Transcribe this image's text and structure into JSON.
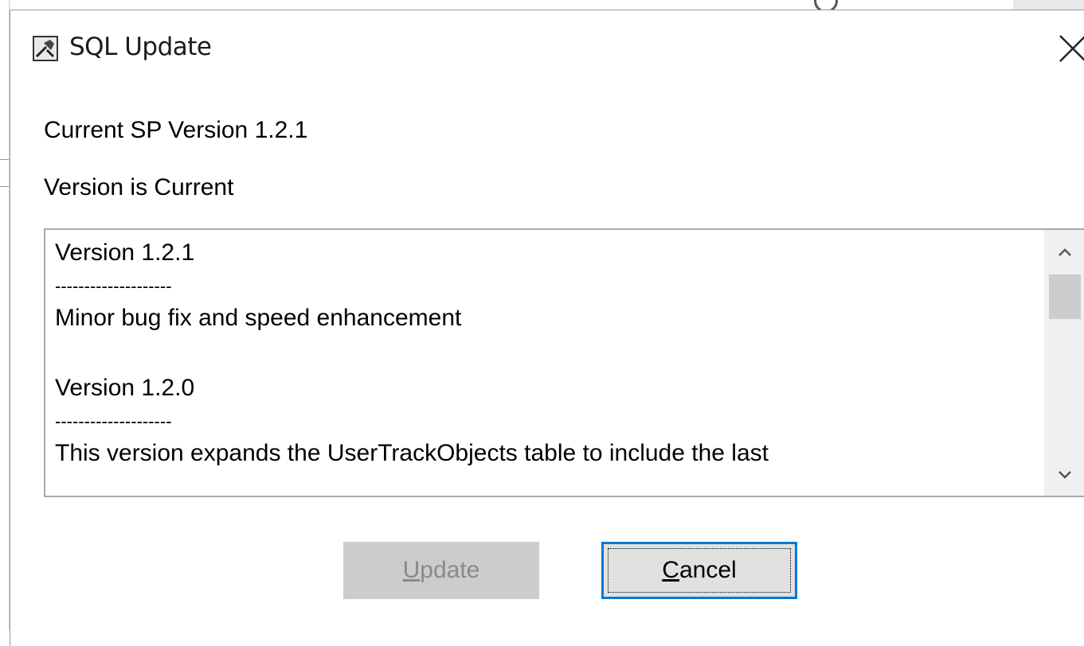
{
  "dialog": {
    "title": "SQL Update",
    "icon": "sql-update-app-icon",
    "close_icon": "close-icon"
  },
  "info": {
    "current_version": "Current SP Version 1.2.1",
    "status": "Version is Current"
  },
  "notes": {
    "lines": [
      "Version 1.2.1",
      "--------------------",
      "Minor bug fix and speed enhancement",
      "",
      "Version 1.2.0",
      "--------------------",
      "This version expands the UserTrackObjects table to include the last"
    ]
  },
  "buttons": {
    "update": {
      "accel": "U",
      "rest": "pdate",
      "enabled": false
    },
    "cancel": {
      "accel": "C",
      "rest": "ancel",
      "enabled": true
    }
  },
  "colors": {
    "focus_border": "#0078d7",
    "disabled_button": "#cccccc",
    "disabled_text": "#8a8a8a"
  }
}
